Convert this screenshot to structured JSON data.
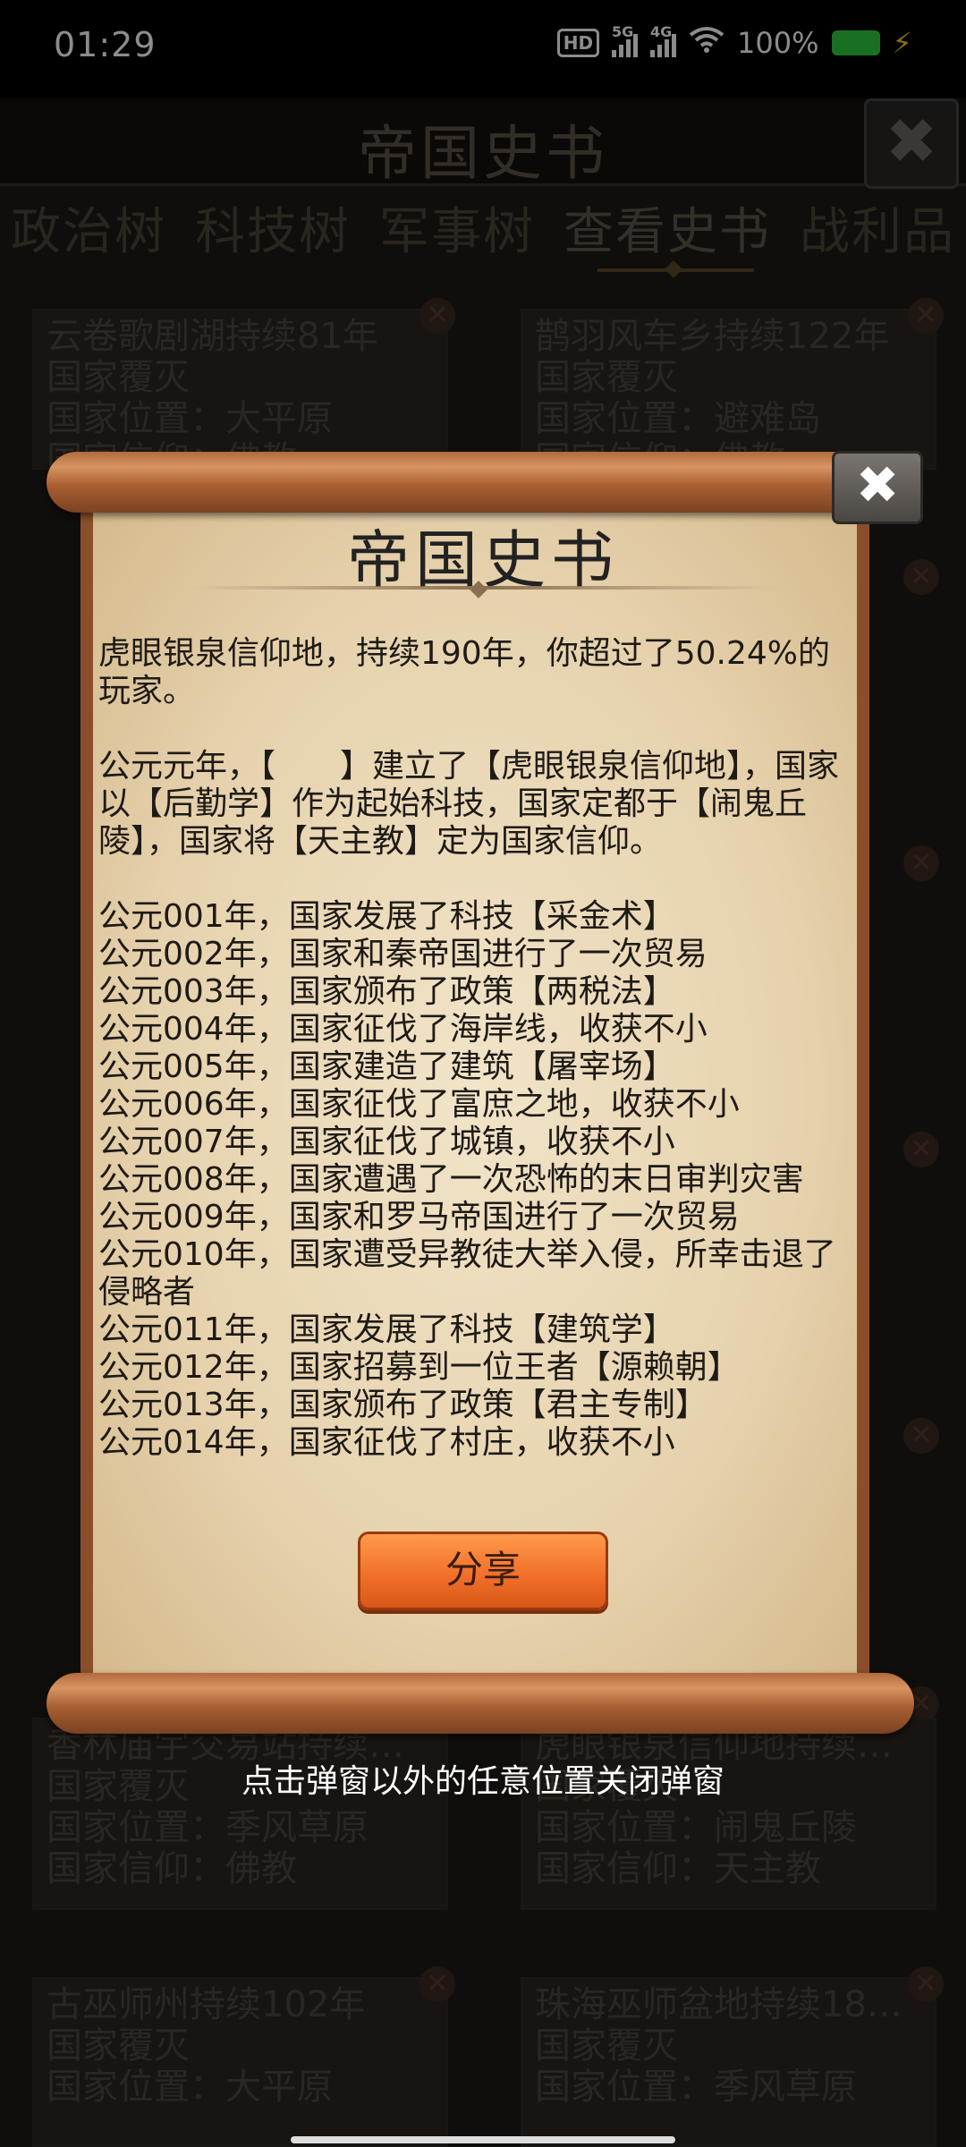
{
  "status_bar": {
    "time": "01:29",
    "hd": "HD",
    "sim1": "5G",
    "sim2": "4G",
    "battery": "100%"
  },
  "app": {
    "title": "帝国史书",
    "close_glyph": "✖"
  },
  "tabs": [
    {
      "label": "政治树"
    },
    {
      "label": "科技树"
    },
    {
      "label": "军事树"
    },
    {
      "label": "查看史书",
      "active": true
    },
    {
      "label": "战利品"
    }
  ],
  "background_cards": [
    {
      "lines": [
        "云卷歌剧湖持续81年",
        "国家覆灭",
        "国家位置：大平原",
        "国家信仰：佛教"
      ]
    },
    {
      "lines": [
        "鹊羽风车乡持续122年",
        "国家覆灭",
        "国家位置：避难岛",
        "国家信仰：佛教"
      ]
    },
    {
      "lines": [
        "香林庙宇交易站持续…",
        "国家覆灭",
        "国家位置：季风草原",
        "国家信仰：佛教"
      ]
    },
    {
      "lines": [
        "虎眼银泉信仰地持续…",
        "国家覆灭",
        "国家位置：闹鬼丘陵",
        "国家信仰：天主教"
      ]
    },
    {
      "lines": [
        "古巫师州持续102年",
        "国家覆灭",
        "国家位置：大平原"
      ]
    },
    {
      "lines": [
        "珠海巫师盆地持续18…",
        "国家覆灭",
        "国家位置：季风草原"
      ]
    }
  ],
  "dialog": {
    "title": "帝国史书",
    "close_glyph": "✖",
    "summary": "虎眼银泉信仰地，持续190年，你超过了50.24%的玩家。",
    "founding": "公元元年，【　　】建立了【虎眼银泉信仰地】，国家以【后勤学】作为起始科技，国家定都于【闹鬼丘陵】，国家将【天主教】定为国家信仰。",
    "events": [
      "公元001年，国家发展了科技【采金术】",
      "公元002年，国家和秦帝国进行了一次贸易",
      "公元003年，国家颁布了政策【两税法】",
      "公元004年，国家征伐了海岸线，收获不小",
      "公元005年，国家建造了建筑【屠宰场】",
      "公元006年，国家征伐了富庶之地，收获不小",
      "公元007年，国家征伐了城镇，收获不小",
      "公元008年，国家遭遇了一次恐怖的末日审判灾害",
      "公元009年，国家和罗马帝国进行了一次贸易",
      "公元010年，国家遭受异教徒大举入侵，所幸击退了侵略者",
      "公元011年，国家发展了科技【建筑学】",
      "公元012年，国家招募到一位王者【源赖朝】",
      "公元013年，国家颁布了政策【君主专制】",
      "公元014年，国家征伐了村庄，收获不小"
    ],
    "share_label": "分享"
  },
  "hint": "点击弹窗以外的任意位置关闭弹窗"
}
